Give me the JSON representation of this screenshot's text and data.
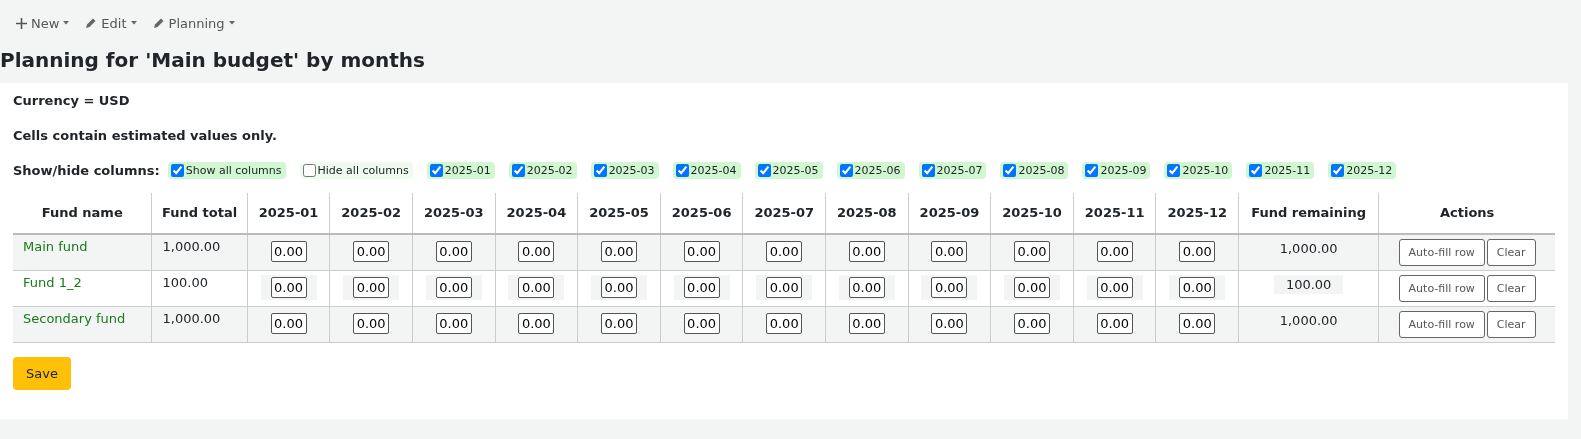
{
  "toolbar": [
    {
      "kind": "plus",
      "label": "New"
    },
    {
      "kind": "pencil",
      "label": "Edit"
    },
    {
      "kind": "pencil",
      "label": "Planning"
    }
  ],
  "title": "Planning for 'Main budget' by months",
  "currency": "Currency = USD",
  "note": "Cells contain estimated values only.",
  "column_toggles": {
    "label": "Show/hide columns:",
    "items": [
      {
        "label": "Show all columns",
        "checked": true
      },
      {
        "label": "Hide all columns",
        "checked": false
      },
      {
        "label": "2025-01",
        "checked": true
      },
      {
        "label": "2025-02",
        "checked": true
      },
      {
        "label": "2025-03",
        "checked": true
      },
      {
        "label": "2025-04",
        "checked": true
      },
      {
        "label": "2025-05",
        "checked": true
      },
      {
        "label": "2025-06",
        "checked": true
      },
      {
        "label": "2025-07",
        "checked": true
      },
      {
        "label": "2025-08",
        "checked": true
      },
      {
        "label": "2025-09",
        "checked": true
      },
      {
        "label": "2025-10",
        "checked": true
      },
      {
        "label": "2025-11",
        "checked": true
      },
      {
        "label": "2025-12",
        "checked": true
      }
    ]
  },
  "table": {
    "columns": [
      "Fund name",
      "Fund total",
      "2025-01",
      "2025-02",
      "2025-03",
      "2025-04",
      "2025-05",
      "2025-06",
      "2025-07",
      "2025-08",
      "2025-09",
      "2025-10",
      "2025-11",
      "2025-12",
      "Fund remaining",
      "Actions"
    ],
    "rows": [
      {
        "name": "Main fund",
        "total": "1,000.00",
        "values": [
          "0.00",
          "0.00",
          "0.00",
          "0.00",
          "0.00",
          "0.00",
          "0.00",
          "0.00",
          "0.00",
          "0.00",
          "0.00",
          "0.00"
        ],
        "remaining": "1,000.00",
        "actions": [
          "Auto-fill row",
          "Clear"
        ]
      },
      {
        "name": "Fund 1_2",
        "total": "100.00",
        "values": [
          "0.00",
          "0.00",
          "0.00",
          "0.00",
          "0.00",
          "0.00",
          "0.00",
          "0.00",
          "0.00",
          "0.00",
          "0.00",
          "0.00"
        ],
        "remaining": "100.00",
        "actions": [
          "Auto-fill row",
          "Clear"
        ]
      },
      {
        "name": "Secondary fund",
        "total": "1,000.00",
        "values": [
          "0.00",
          "0.00",
          "0.00",
          "0.00",
          "0.00",
          "0.00",
          "0.00",
          "0.00",
          "0.00",
          "0.00",
          "0.00",
          "0.00"
        ],
        "remaining": "1,000.00",
        "actions": [
          "Auto-fill row",
          "Clear"
        ]
      }
    ]
  },
  "save": "Save"
}
